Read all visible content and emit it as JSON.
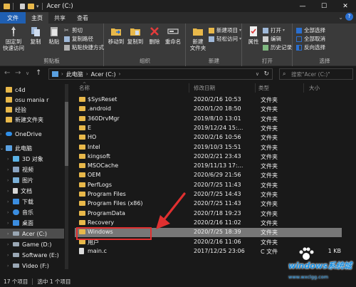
{
  "titlebar": {
    "title": "Acer (C:)",
    "minimize": "—",
    "maximize": "☐",
    "close": "✕"
  },
  "tabs": [
    {
      "label": "文件"
    },
    {
      "label": "主页"
    },
    {
      "label": "共享"
    },
    {
      "label": "查看"
    }
  ],
  "ribbon": {
    "clipboard": {
      "pin_label": "固定到\n快速访问",
      "copy_label": "复制",
      "paste_label": "粘贴",
      "cut_label": "剪切",
      "copy_path_label": "复制路径",
      "paste_shortcut_label": "粘贴快捷方式",
      "group_label": "剪贴板"
    },
    "organize": {
      "move_to_label": "移动到",
      "copy_to_label": "复制到",
      "delete_label": "删除",
      "rename_label": "重命名",
      "group_label": "组织"
    },
    "new": {
      "new_folder_label": "新建\n文件夹",
      "new_item_label": "新建项目",
      "easy_access_label": "轻松访问",
      "group_label": "新建"
    },
    "open": {
      "properties_label": "属性",
      "open_label": "打开",
      "edit_label": "编辑",
      "history_label": "历史记录",
      "group_label": "打开"
    },
    "select": {
      "select_all_label": "全部选择",
      "select_none_label": "全部取消",
      "invert_label": "反向选择",
      "group_label": "选择"
    }
  },
  "address": {
    "path": [
      "此电脑",
      "Acer (C:)"
    ],
    "search_placeholder": "搜索\"Acer (C:)\""
  },
  "nav": {
    "items": [
      {
        "label": "c4d",
        "kind": "folder"
      },
      {
        "label": "osu mania r",
        "kind": "folder"
      },
      {
        "label": "经验",
        "kind": "folder"
      },
      {
        "label": "新建文件夹",
        "kind": "folder"
      },
      {
        "label": "OneDrive",
        "kind": "cloud"
      },
      {
        "label": "此电脑",
        "kind": "pc"
      },
      {
        "label": "3D 对象",
        "kind": "obj3d"
      },
      {
        "label": "视频",
        "kind": "video"
      },
      {
        "label": "图片",
        "kind": "pictures"
      },
      {
        "label": "文档",
        "kind": "docs"
      },
      {
        "label": "下载",
        "kind": "download"
      },
      {
        "label": "音乐",
        "kind": "music"
      },
      {
        "label": "桌面",
        "kind": "desktop"
      },
      {
        "label": "Acer (C:)",
        "kind": "drive"
      },
      {
        "label": "Game (D:)",
        "kind": "drive"
      },
      {
        "label": "Software (E:)",
        "kind": "drive"
      },
      {
        "label": "Video (F:)",
        "kind": "drive"
      }
    ]
  },
  "columns": {
    "name": "名称",
    "date": "修改日期",
    "type": "类型",
    "size": "大小"
  },
  "files": [
    {
      "name": "$SysReset",
      "date": "2020/2/16 10:53",
      "type": "文件夹",
      "size": ""
    },
    {
      "name": ".android",
      "date": "2020/1/20 18:50",
      "type": "文件夹",
      "size": ""
    },
    {
      "name": "360DrvMgr",
      "date": "2019/8/10 13:01",
      "type": "文件夹",
      "size": ""
    },
    {
      "name": "E",
      "date": "2019/12/24 15:…",
      "type": "文件夹",
      "size": ""
    },
    {
      "name": "HO",
      "date": "2020/2/16 10:56",
      "type": "文件夹",
      "size": ""
    },
    {
      "name": "Intel",
      "date": "2019/10/3 15:51",
      "type": "文件夹",
      "size": ""
    },
    {
      "name": "kingsoft",
      "date": "2020/2/21 23:43",
      "type": "文件夹",
      "size": ""
    },
    {
      "name": "MSOCache",
      "date": "2019/11/13 17:…",
      "type": "文件夹",
      "size": ""
    },
    {
      "name": "OEM",
      "date": "2020/6/29 21:56",
      "type": "文件夹",
      "size": ""
    },
    {
      "name": "PerfLogs",
      "date": "2020/7/25 11:43",
      "type": "文件夹",
      "size": ""
    },
    {
      "name": "Program Files",
      "date": "2020/7/25 14:43",
      "type": "文件夹",
      "size": ""
    },
    {
      "name": "Program Files (x86)",
      "date": "2020/7/25 11:43",
      "type": "文件夹",
      "size": ""
    },
    {
      "name": "ProgramData",
      "date": "2020/7/18 19:23",
      "type": "文件夹",
      "size": ""
    },
    {
      "name": "Recovery",
      "date": "2020/2/16 11:02",
      "type": "文件夹",
      "size": ""
    },
    {
      "name": "Windows",
      "date": "2020/7/25 18:39",
      "type": "文件夹",
      "size": ""
    },
    {
      "name": "用户",
      "date": "2020/2/16 11:06",
      "type": "文件夹",
      "size": ""
    },
    {
      "name": "main.c",
      "date": "2017/12/25 23:06",
      "type": "C 文件",
      "size": "1 KB"
    }
  ],
  "status": {
    "count": "17 个项目",
    "selected": "选中 1 个项目"
  },
  "watermark": {
    "logo": "windows系统城",
    "url": "www.wxclgg.com"
  },
  "colors": {
    "accent": "#1f5fb2",
    "folder": "#e8b84a",
    "highlight": "#e03030"
  }
}
